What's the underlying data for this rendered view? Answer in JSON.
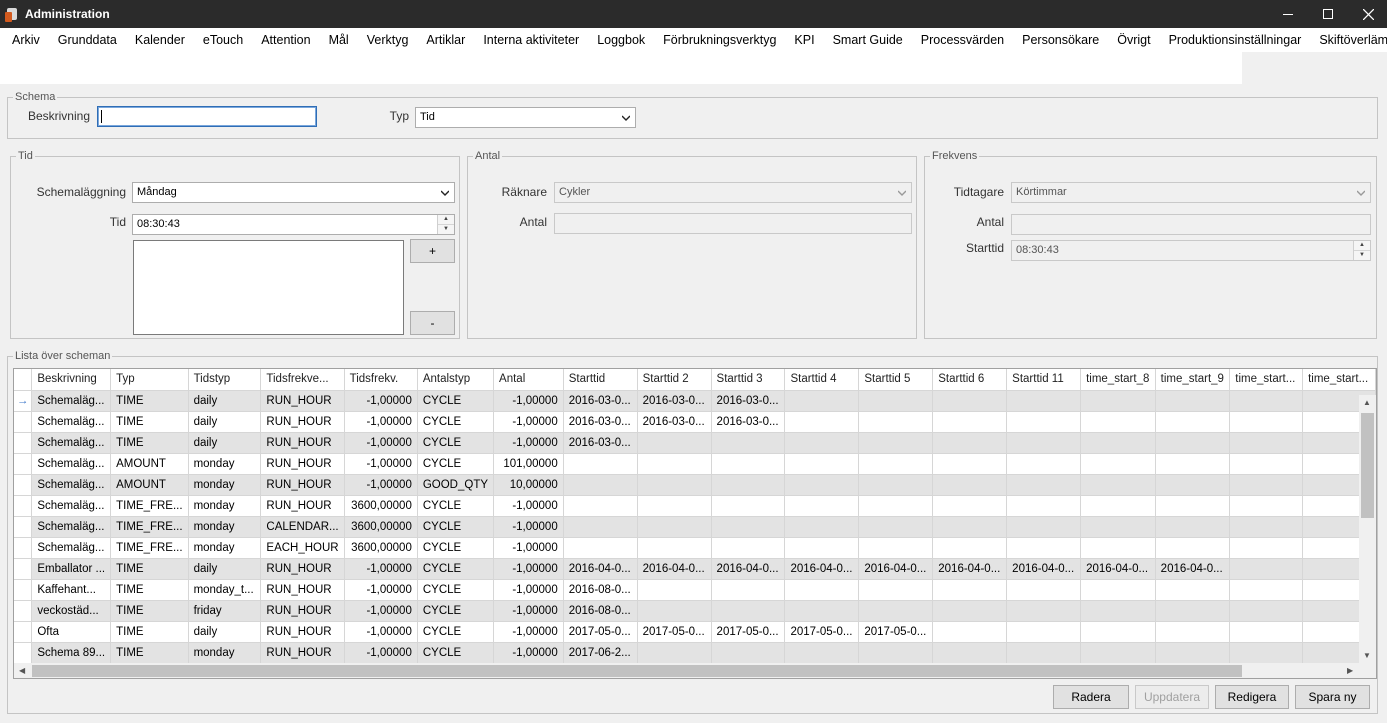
{
  "window": {
    "title": "Administration"
  },
  "menu": [
    "Arkiv",
    "Grunddata",
    "Kalender",
    "eTouch",
    "Attention",
    "Mål",
    "Verktyg",
    "Artiklar",
    "Interna aktiviteter",
    "Loggbok",
    "Förbrukningsverktyg",
    "KPI",
    "Smart Guide",
    "Processvärden",
    "Personsökare",
    "Övrigt",
    "Produktionsinställningar",
    "Skiftöverlämning"
  ],
  "schema": {
    "legend": "Schema",
    "beskrivning_label": "Beskrivning",
    "beskrivning_value": "",
    "typ_label": "Typ",
    "typ_value": "Tid"
  },
  "tid": {
    "legend": "Tid",
    "schemalaggning_label": "Schemaläggning",
    "schemalaggning_value": "Måndag",
    "tid_label": "Tid",
    "tid_value": "08:30:43",
    "add_label": "+",
    "remove_label": "-"
  },
  "antal": {
    "legend": "Antal",
    "raknare_label": "Räknare",
    "raknare_value": "Cykler",
    "antal_label": "Antal",
    "antal_value": ""
  },
  "frekvens": {
    "legend": "Frekvens",
    "tidtagare_label": "Tidtagare",
    "tidtagare_value": "Körtimmar",
    "antal_label": "Antal",
    "antal_value": "",
    "starttid_label": "Starttid",
    "starttid_value": "08:30:43"
  },
  "lista": {
    "legend": "Lista över scheman",
    "columns": [
      "Beskrivning",
      "Typ",
      "Tidstyp",
      "Tidsfrekve...",
      "Tidsfrekv.",
      "Antalstyp",
      "Antal",
      "Starttid",
      "Starttid 2",
      "Starttid 3",
      "Starttid 4",
      "Starttid 5",
      "Starttid 6",
      "Starttid 11",
      "time_start_8",
      "time_start_9",
      "time_start...",
      "time_start..."
    ],
    "rows": [
      [
        "Schemaläg...",
        "TIME",
        "daily",
        "RUN_HOUR",
        "-1,00000",
        "CYCLE",
        "-1,00000",
        "2016-03-0...",
        "2016-03-0...",
        "2016-03-0...",
        "",
        "",
        "",
        "",
        "",
        "",
        "",
        ""
      ],
      [
        "Schemaläg...",
        "TIME",
        "daily",
        "RUN_HOUR",
        "-1,00000",
        "CYCLE",
        "-1,00000",
        "2016-03-0...",
        "2016-03-0...",
        "2016-03-0...",
        "",
        "",
        "",
        "",
        "",
        "",
        "",
        ""
      ],
      [
        "Schemaläg...",
        "TIME",
        "daily",
        "RUN_HOUR",
        "-1,00000",
        "CYCLE",
        "-1,00000",
        "2016-03-0...",
        "",
        "",
        "",
        "",
        "",
        "",
        "",
        "",
        "",
        ""
      ],
      [
        "Schemaläg...",
        "AMOUNT",
        "monday",
        "RUN_HOUR",
        "-1,00000",
        "CYCLE",
        "101,00000",
        "",
        "",
        "",
        "",
        "",
        "",
        "",
        "",
        "",
        "",
        ""
      ],
      [
        "Schemaläg...",
        "AMOUNT",
        "monday",
        "RUN_HOUR",
        "-1,00000",
        "GOOD_QTY",
        "10,00000",
        "",
        "",
        "",
        "",
        "",
        "",
        "",
        "",
        "",
        "",
        ""
      ],
      [
        "Schemaläg...",
        "TIME_FRE...",
        "monday",
        "RUN_HOUR",
        "3600,00000",
        "CYCLE",
        "-1,00000",
        "",
        "",
        "",
        "",
        "",
        "",
        "",
        "",
        "",
        "",
        ""
      ],
      [
        "Schemaläg...",
        "TIME_FRE...",
        "monday",
        "CALENDAR...",
        "3600,00000",
        "CYCLE",
        "-1,00000",
        "",
        "",
        "",
        "",
        "",
        "",
        "",
        "",
        "",
        "",
        ""
      ],
      [
        "Schemaläg...",
        "TIME_FRE...",
        "monday",
        "EACH_HOUR",
        "3600,00000",
        "CYCLE",
        "-1,00000",
        "",
        "",
        "",
        "",
        "",
        "",
        "",
        "",
        "",
        "",
        ""
      ],
      [
        "Emballator ...",
        "TIME",
        "daily",
        "RUN_HOUR",
        "-1,00000",
        "CYCLE",
        "-1,00000",
        "2016-04-0...",
        "2016-04-0...",
        "2016-04-0...",
        "2016-04-0...",
        "2016-04-0...",
        "2016-04-0...",
        "2016-04-0...",
        "2016-04-0...",
        "2016-04-0...",
        "",
        ""
      ],
      [
        "Kaffehant...",
        "TIME",
        "monday_t...",
        "RUN_HOUR",
        "-1,00000",
        "CYCLE",
        "-1,00000",
        "2016-08-0...",
        "",
        "",
        "",
        "",
        "",
        "",
        "",
        "",
        "",
        ""
      ],
      [
        "veckostäd...",
        "TIME",
        "friday",
        "RUN_HOUR",
        "-1,00000",
        "CYCLE",
        "-1,00000",
        "2016-08-0...",
        "",
        "",
        "",
        "",
        "",
        "",
        "",
        "",
        "",
        ""
      ],
      [
        "Ofta",
        "TIME",
        "daily",
        "RUN_HOUR",
        "-1,00000",
        "CYCLE",
        "-1,00000",
        "2017-05-0...",
        "2017-05-0...",
        "2017-05-0...",
        "2017-05-0...",
        "2017-05-0...",
        "",
        "",
        "",
        "",
        "",
        ""
      ],
      [
        "Schema 89...",
        "TIME",
        "monday",
        "RUN_HOUR",
        "-1,00000",
        "CYCLE",
        "-1,00000",
        "2017-06-2...",
        "",
        "",
        "",
        "",
        "",
        "",
        "",
        "",
        "",
        ""
      ]
    ],
    "selected_row_indicator": "→"
  },
  "buttons": {
    "radera": "Radera",
    "uppdatera": "Uppdatera",
    "redigera": "Redigera",
    "spara_ny": "Spara ny"
  }
}
